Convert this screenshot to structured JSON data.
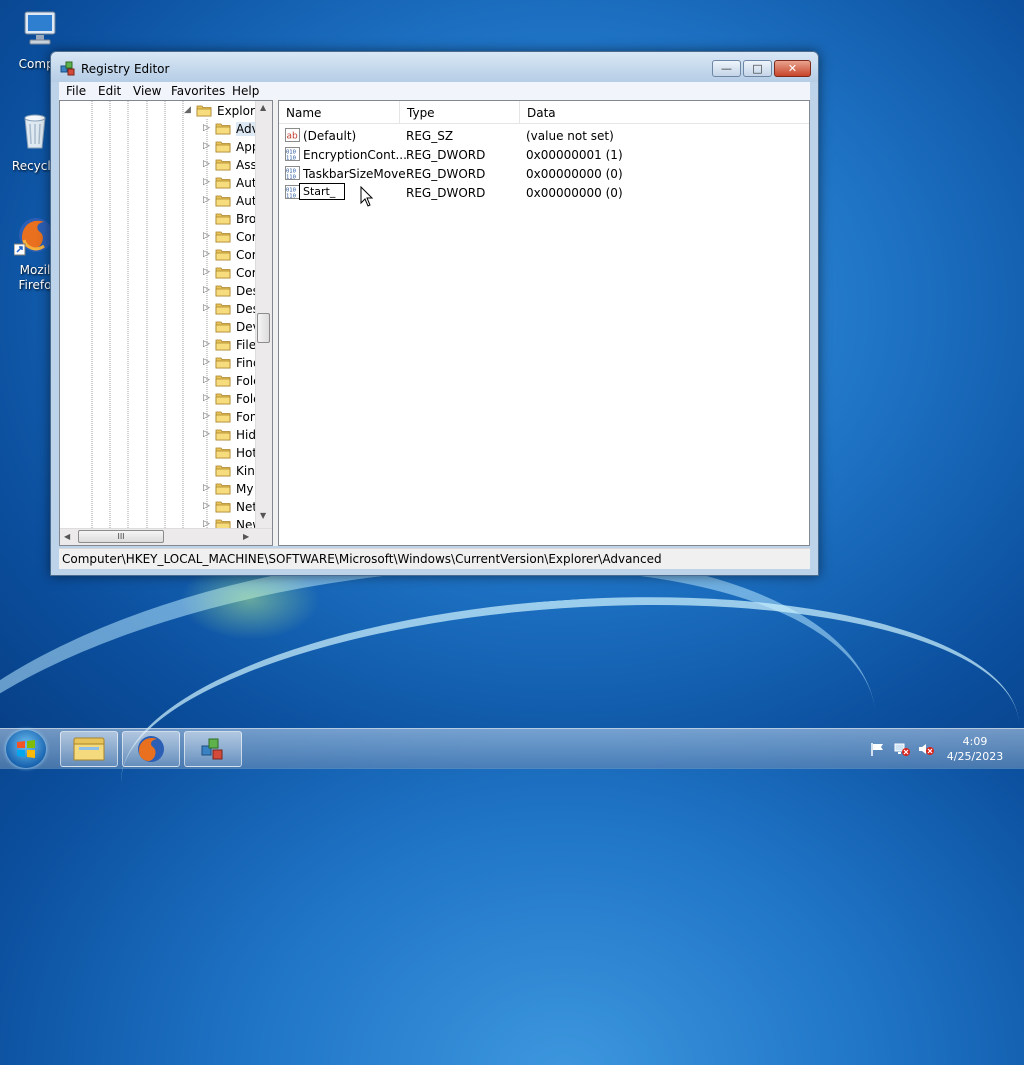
{
  "desktop": {
    "icons": [
      {
        "label": "Compu"
      },
      {
        "label": "Recycle"
      },
      {
        "label": "Mozil",
        "label2": "Firefo"
      }
    ]
  },
  "window": {
    "title": "Registry Editor",
    "controls": {
      "minimize": "—",
      "maximize": "□",
      "close": "✕"
    },
    "menu": [
      "File",
      "Edit",
      "View",
      "Favorites",
      "Help"
    ]
  },
  "tree": {
    "root": "Explore",
    "items": [
      "Adv",
      "App",
      "Ass",
      "Aut",
      "Aut",
      "Bro",
      "Cor",
      "Cor",
      "Cor",
      "Des",
      "Des",
      "Dev",
      "File",
      "Find",
      "Folc",
      "Folc",
      "Fon",
      "Hid",
      "Hot",
      "Kin",
      "My",
      "Net",
      "New"
    ],
    "scroll_glyph": "III"
  },
  "list": {
    "columns": [
      "Name",
      "Type",
      "Data"
    ],
    "rows": [
      {
        "icon": "string-value-icon",
        "name": "(Default)",
        "type": "REG_SZ",
        "data": "(value not set)"
      },
      {
        "icon": "dword-value-icon",
        "name": "EncryptionCont...",
        "type": "REG_DWORD",
        "data": "0x00000001 (1)"
      },
      {
        "icon": "dword-value-icon",
        "name": "TaskbarSizeMove",
        "type": "REG_DWORD",
        "data": "0x00000000 (0)"
      },
      {
        "icon": "dword-value-icon",
        "name": "Start_",
        "type": "REG_DWORD",
        "data": "0x00000000 (0)"
      }
    ],
    "rename_value": "Start_"
  },
  "statusbar": {
    "path": "Computer\\HKEY_LOCAL_MACHINE\\SOFTWARE\\Microsoft\\Windows\\CurrentVersion\\Explorer\\Advanced"
  },
  "taskbar": {
    "clock_time": "4:09",
    "clock_date": "4/25/2023"
  }
}
